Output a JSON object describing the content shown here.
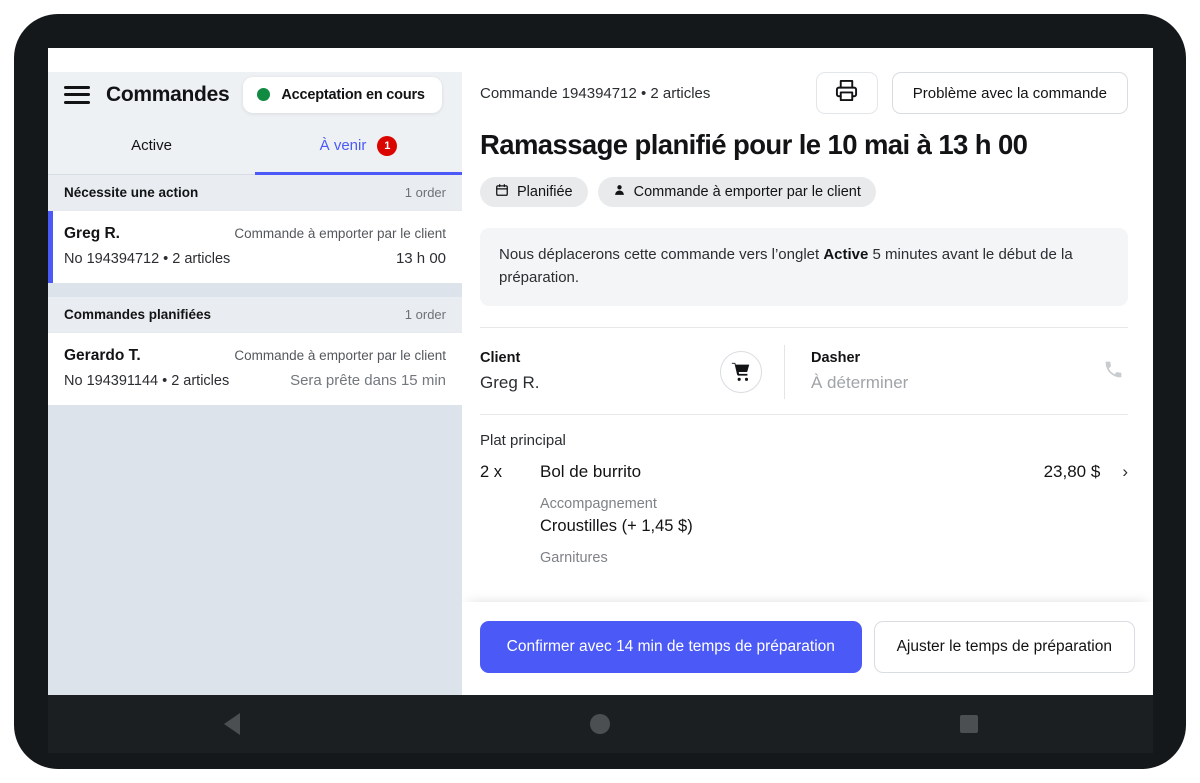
{
  "sidebar": {
    "menu_icon": "hamburger-menu-icon",
    "title": "Commandes",
    "status": {
      "label": "Acceptation en cours",
      "dot_color": "#128b42"
    },
    "tabs": [
      {
        "label": "Active",
        "active": false,
        "badge": ""
      },
      {
        "label": "À venir",
        "active": true,
        "badge": "1"
      }
    ],
    "groups": [
      {
        "title": "Nécessite une action",
        "count": "1 order",
        "orders": [
          {
            "name": "Greg R.",
            "type": "Commande à emporter par le client",
            "number": "No 194394712 • 2 articles",
            "time": "13 h 00",
            "selected": true
          }
        ]
      },
      {
        "title": "Commandes planifiées",
        "count": "1 order",
        "orders": [
          {
            "name": "Gerardo T.",
            "type": "Commande à emporter par le client",
            "number": "No 194391144 • 2 articles",
            "time": "Sera prête dans 15 min",
            "selected": false
          }
        ]
      }
    ]
  },
  "main": {
    "order_meta": "Commande 194394712 • 2 articles",
    "print_button_icon": "printer-icon",
    "problem_button": "Problème avec la commande",
    "title": "Ramassage planifié pour le 10 mai à 13 h 00",
    "chips": [
      {
        "icon": "calendar-icon",
        "label": "Planifiée"
      },
      {
        "icon": "person-icon",
        "label": "Commande à emporter par le client"
      }
    ],
    "notice": {
      "before": "Nous déplacerons cette commande vers l’onglet ",
      "bold": "Active",
      "after": " 5 minutes avant le début de la préparation."
    },
    "customer": {
      "label": "Client",
      "value": "Greg R."
    },
    "cart_icon": "shopping-cart-icon",
    "dasher": {
      "label": "Dasher",
      "value": "À déterminer"
    },
    "phone_icon": "phone-icon",
    "items_section_label": "Plat principal",
    "items": [
      {
        "qty": "2 x",
        "name": "Bol de burrito",
        "price": "23,80 $",
        "chevron_icon": "chevron-right-icon",
        "options": [
          {
            "label": "Accompagnement",
            "value": "Croustilles (+ 1,45 $)"
          },
          {
            "label": "Garnitures",
            "value": ""
          }
        ]
      }
    ],
    "actions": {
      "primary": "Confirmer avec 14 min de temps de préparation",
      "secondary": "Ajuster le temps de préparation"
    }
  },
  "device": {
    "nav_back_icon": "nav-back-icon",
    "nav_home_icon": "nav-home-icon",
    "nav_recents_icon": "nav-recents-icon"
  },
  "colors": {
    "accent": "#4b59f7",
    "badge": "#db0500",
    "status": "#128b42"
  }
}
